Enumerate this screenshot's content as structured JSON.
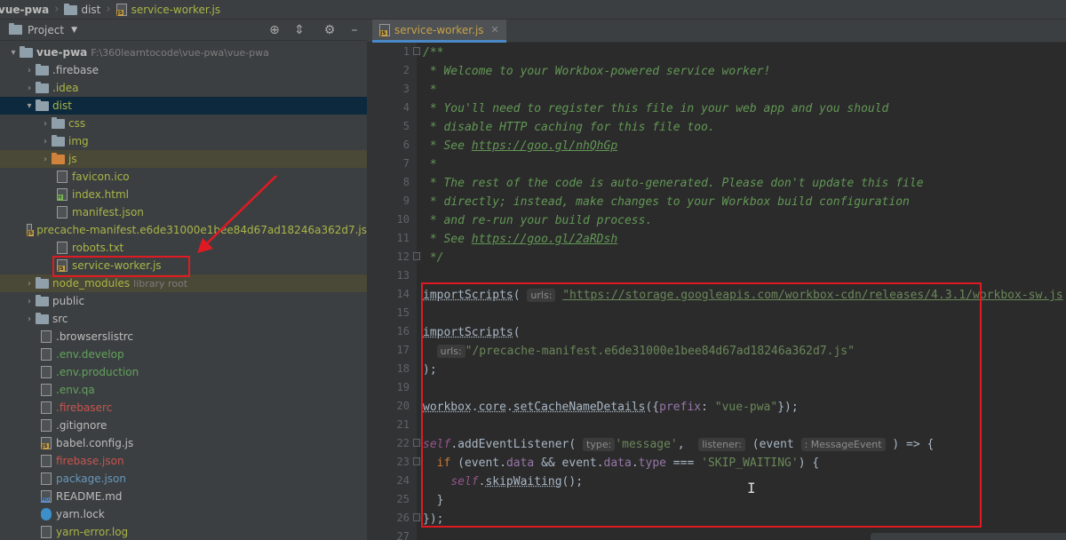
{
  "breadcrumb": [
    "vue-pwa",
    "dist",
    "service-worker.js"
  ],
  "project_panel": {
    "title": "Project",
    "tools": [
      "target-icon",
      "collapse-icon",
      "gear-icon",
      "minimize-icon"
    ]
  },
  "tree": [
    {
      "label": "vue-pwa",
      "path": "F:\\360learntocode\\vue-pwa\\vue-pwa",
      "type": "root"
    },
    {
      "label": ".firebase",
      "type": "folder"
    },
    {
      "label": ".idea",
      "type": "folder"
    },
    {
      "label": "dist",
      "type": "folder",
      "open": true
    },
    {
      "label": "css",
      "type": "folder"
    },
    {
      "label": "img",
      "type": "folder"
    },
    {
      "label": "js",
      "type": "folder"
    },
    {
      "label": "favicon.ico",
      "type": "file"
    },
    {
      "label": "index.html",
      "type": "file"
    },
    {
      "label": "manifest.json",
      "type": "file"
    },
    {
      "label": "precache-manifest.e6de31000e1bee84d67ad18246a362d7.js",
      "type": "file"
    },
    {
      "label": "robots.txt",
      "type": "file"
    },
    {
      "label": "service-worker.js",
      "type": "file"
    },
    {
      "label": "node_modules",
      "extra": "library root",
      "type": "folder"
    },
    {
      "label": "public",
      "type": "folder"
    },
    {
      "label": "src",
      "type": "folder"
    },
    {
      "label": ".browserslistrc",
      "type": "file"
    },
    {
      "label": ".env.develop",
      "type": "file"
    },
    {
      "label": ".env.production",
      "type": "file"
    },
    {
      "label": ".env.qa",
      "type": "file"
    },
    {
      "label": ".firebaserc",
      "type": "file"
    },
    {
      "label": ".gitignore",
      "type": "file"
    },
    {
      "label": "babel.config.js",
      "type": "file"
    },
    {
      "label": "firebase.json",
      "type": "file"
    },
    {
      "label": "package.json",
      "type": "file"
    },
    {
      "label": "README.md",
      "type": "file"
    },
    {
      "label": "yarn.lock",
      "type": "file"
    },
    {
      "label": "yarn-error.log",
      "type": "file"
    }
  ],
  "editor": {
    "tab": "service-worker.js",
    "line_numbers": [
      "1",
      "2",
      "3",
      "4",
      "5",
      "6",
      "7",
      "8",
      "9",
      "10",
      "11",
      "12",
      "13",
      "14",
      "15",
      "16",
      "17",
      "18",
      "19",
      "20",
      "21",
      "22",
      "23",
      "24",
      "25",
      "26",
      "27"
    ],
    "comment": {
      "l1": "/**",
      "l2": " * Welcome to your Workbox-powered service worker!",
      "l3": " *",
      "l4": " * You'll need to register this file in your web app and you should",
      "l5": " * disable HTTP caching for this file too.",
      "l6_prefix": " * See ",
      "l6_link": "https://goo.gl/nhQhGp",
      "l7": " *",
      "l8": " * The rest of the code is auto-generated. Please don't update this file",
      "l9": " * directly; instead, make changes to your Workbox build configuration",
      "l10": " * and re-run your build process.",
      "l11_prefix": " * See ",
      "l11_link": "https://goo.gl/2aRDsh",
      "l12": " */"
    },
    "code": {
      "import_fn": "importScripts",
      "paren_open": "(",
      "hint_urls": "urls:",
      "cdn_url": "\"https://storage.googleapis.com/workbox-cdn/releases/4.3.1/workbox-sw.js",
      "manifest": "\"/precache-manifest.e6de31000e1bee84d67ad18246a362d7.js\"",
      "close_stmt": ");",
      "workbox": "workbox",
      "dot": ".",
      "core": "core",
      "set_cache": "setCacheNameDetails",
      "obj_open": "({",
      "prefix_key": "prefix",
      "colon": ": ",
      "prefix_val": "\"vue-pwa\"",
      "obj_close": "});",
      "self_kw": "self",
      "add_listener": "addEventListener",
      "hint_type": "type:",
      "msg": "'message'",
      "comma": ", ",
      "hint_listener": "listener:",
      "event_open": "(event",
      "hint_event": ": MessageEvent",
      "arrow_fn": ") => {",
      "if_kw": "if",
      "cond_open": " (event.",
      "data": "data",
      "and": " && event.",
      "type": "type",
      "eq": " === ",
      "skip_str": "'SKIP_WAITING'",
      "cond_close": ") {",
      "skip_fn": "skipWaiting",
      "call_end": "();",
      "brace_close": "}",
      "block_close": "});"
    }
  }
}
